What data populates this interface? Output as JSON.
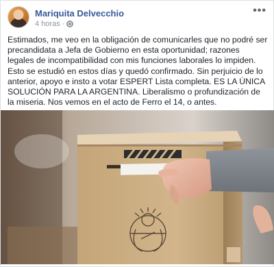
{
  "post": {
    "author": "Mariquita Delvecchio",
    "timestamp": "4 horas",
    "separator": "·",
    "more_icon": "more-options-icon",
    "audience_icon": "globe-icon",
    "text": "Estimados, me veo en la obligación de comunicarles que no podré ser precandidata a Jefa de Gobierno en esta oportunidad; razones legales de incompatibilidad con mis funciones laborales lo impiden. Esto se estudió en estos días y quedó confirmado. Sin perjuicio de lo anterior, apoyo e insto a votar ESPERT Lista completa. ES LA ÚNICA SOLUCIÓN PARA LA ARGENTINA. Liberalismo o profundización de la miseria. Nos vemos en el acto de Ferro el 14, o antes.",
    "image_subject": "hand-inserting-ballot-into-box"
  },
  "colors": {
    "author_link": "#365899",
    "meta_gray": "#90949c",
    "body_text": "#1d2129",
    "card_border": "#dddfe2"
  }
}
